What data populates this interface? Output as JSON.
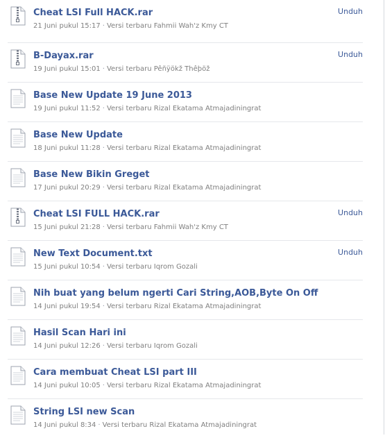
{
  "files": [
    {
      "title": "Cheat LSI Full HACK.rar",
      "date": "21 Juni pukul 15:17",
      "version_text": "Versi terbaru Fahmii Wah'z Kmy CT",
      "action": "Unduh",
      "zipper": true
    },
    {
      "title": "B-Dayax.rar",
      "date": "19 Juni pukul 15:01",
      "version_text": "Versi terbaru Pêñÿökž Thêþöž",
      "action": "Unduh",
      "zipper": true
    },
    {
      "title": "Base New Update 19 June 2013",
      "date": "19 Juni pukul 11:52",
      "version_text": "Versi terbaru Rizal Ekatama Atmajadiningrat",
      "action": "",
      "zipper": false
    },
    {
      "title": "Base New Update",
      "date": "18 Juni pukul 11:28",
      "version_text": "Versi terbaru Rizal Ekatama Atmajadiningrat",
      "action": "",
      "zipper": false
    },
    {
      "title": "Base New Bikin Greget",
      "date": "17 Juni pukul 20:29",
      "version_text": "Versi terbaru Rizal Ekatama Atmajadiningrat",
      "action": "",
      "zipper": false
    },
    {
      "title": "Cheat LSI FULL HACK.rar",
      "date": "15 Juni pukul 21:28",
      "version_text": "Versi terbaru Fahmii Wah'z Kmy CT",
      "action": "Unduh",
      "zipper": true
    },
    {
      "title": "New Text Document.txt",
      "date": "15 Juni pukul 10:54",
      "version_text": "Versi terbaru Iqrom Gozali",
      "action": "Unduh",
      "zipper": false
    },
    {
      "title": "Nih buat yang belum ngerti Cari String,AOB,Byte On Off",
      "date": "14 Juni pukul 19:54",
      "version_text": "Versi terbaru Rizal Ekatama Atmajadiningrat",
      "action": "",
      "zipper": false
    },
    {
      "title": "Hasil Scan Hari ini",
      "date": "14 Juni pukul 12:26",
      "version_text": "Versi terbaru Iqrom Gozali",
      "action": "",
      "zipper": false
    },
    {
      "title": "Cara membuat Cheat LSI part III",
      "date": "14 Juni pukul 10:05",
      "version_text": "Versi terbaru Rizal Ekatama Atmajadiningrat",
      "action": "",
      "zipper": false
    },
    {
      "title": "String LSI new Scan",
      "date": "14 Juni pukul 8:34",
      "version_text": "Versi terbaru Rizal Ekatama Atmajadiningrat",
      "action": "",
      "zipper": false
    }
  ],
  "separator": "·",
  "icons": {
    "file": "document-icon",
    "archive": "archive-file-icon"
  },
  "colors": {
    "link": "#3b5998",
    "meta": "#7f7f7f",
    "divider": "#e5e7eb"
  }
}
